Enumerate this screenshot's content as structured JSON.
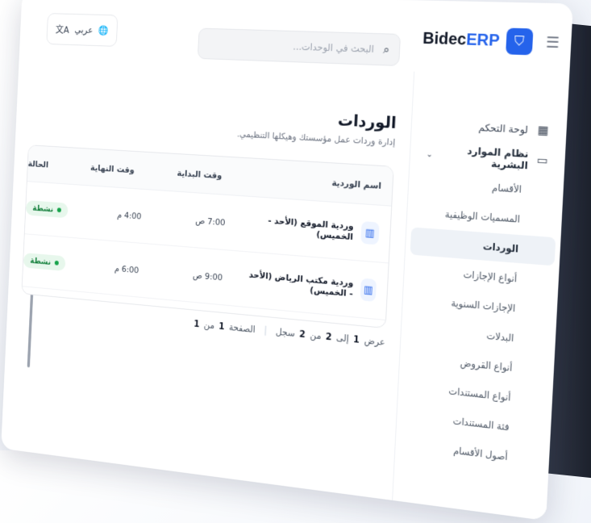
{
  "brand": {
    "name_main": "Bidec",
    "name_accent": "ERP"
  },
  "search": {
    "placeholder": "البحث في الوحدات..."
  },
  "language": {
    "label": "عربي"
  },
  "sidebar": {
    "dashboard": "لوحة التحكم",
    "hr_group": "نظام الموارد البشرية",
    "items": [
      {
        "label": "الأقسام"
      },
      {
        "label": "المسميات الوظيفية"
      },
      {
        "label": "الوردات",
        "active": true
      },
      {
        "label": "أنواع الإجازات"
      },
      {
        "label": "الإجازات السنوية"
      },
      {
        "label": "البدلات"
      },
      {
        "label": "أنواع القروض"
      },
      {
        "label": "أنواع المستندات"
      },
      {
        "label": "فئة المستندات"
      },
      {
        "label": "أصول الأقسام"
      }
    ]
  },
  "page": {
    "title": "الوردات",
    "subtitle": "إدارة وردات عمل مؤسستك وهيكلها التنظيمي."
  },
  "table": {
    "headers": {
      "name": "اسم الوردية",
      "start": "وقت البداية",
      "end": "وقت النهاية",
      "status": "الحالة"
    },
    "rows": [
      {
        "name": "وردية الموقع (الأحد - الخميس)",
        "start": "7:00 ص",
        "end": "4:00 م",
        "status": "نشطة"
      },
      {
        "name": "وردية مكتب الرياض (الأحد - الخميس)",
        "start": "9:00 ص",
        "end": "6:00 م",
        "status": "نشطة"
      }
    ]
  },
  "pagination": {
    "show": "عرض",
    "from": "1",
    "to_word": "إلى",
    "to": "2",
    "of_word": "من",
    "total": "2",
    "records": "سجل",
    "page_word": "الصفحة",
    "page": "1",
    "page_of": "من",
    "pages": "1"
  },
  "colors": {
    "accent": "#2563eb",
    "active_badge_bg": "#e7f7ec",
    "active_badge_text": "#15803d"
  }
}
